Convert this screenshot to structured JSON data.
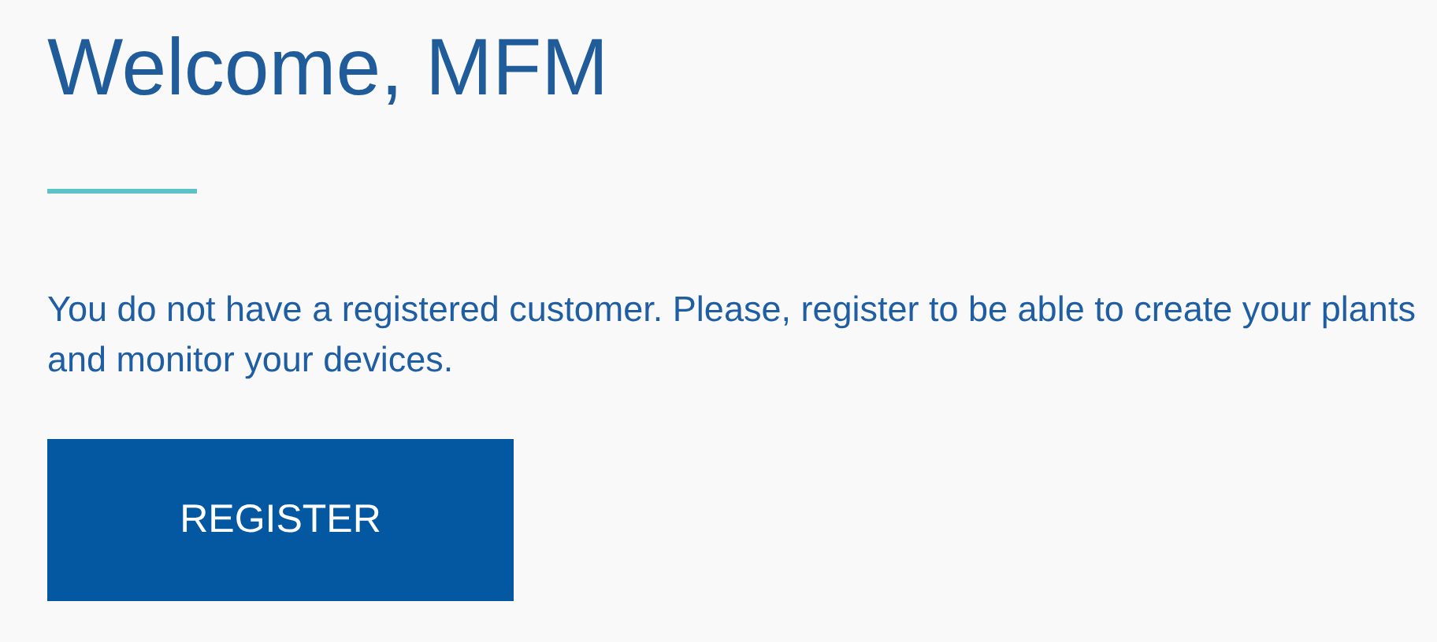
{
  "heading": "Welcome, MFM",
  "message": "You do not have a registered customer. Please, register to be able to create your plants and monitor your devices.",
  "register_button": "REGISTER"
}
